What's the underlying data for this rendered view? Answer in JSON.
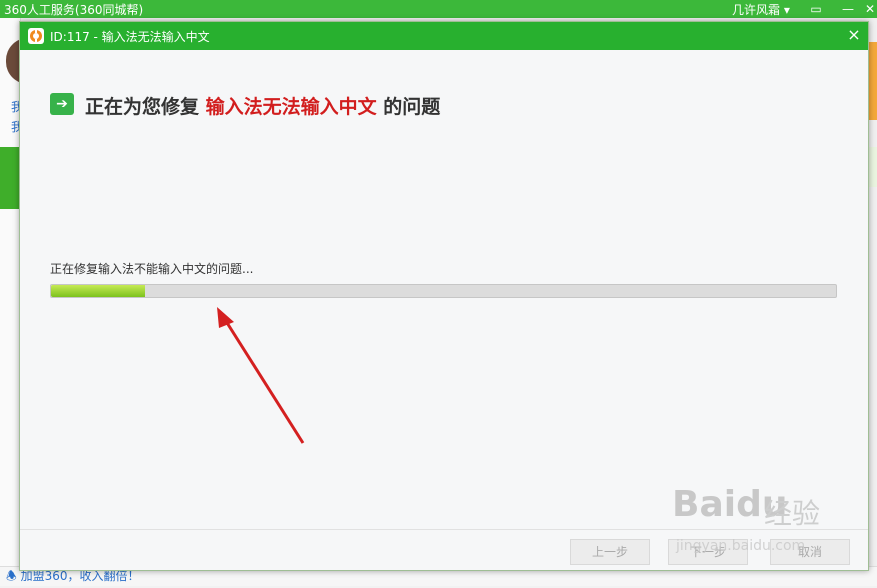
{
  "background_window": {
    "title": "360人工服务(360同城帮)",
    "user_menu": "几许风霜 ▾",
    "link_1": "我",
    "link_2": "我",
    "bottom_text": "加盟360，收入翻倍！"
  },
  "dialog": {
    "title": "ID:117 - 输入法无法输入中文",
    "close_glyph": "×",
    "heading_prefix": "正在为您修复 ",
    "heading_highlight": "输入法无法输入中文",
    "heading_suffix": " 的问题",
    "status_text": "正在修复输入法不能输入中文的问题...",
    "progress_percent": 12,
    "buttons": {
      "prev": "上一步",
      "next": "下一步",
      "cancel": "取消"
    }
  },
  "watermark": {
    "brand": "Baidu",
    "sub": "经验",
    "url": "jingyan.baidu.com"
  },
  "colors": {
    "title_green": "#28b02f",
    "highlight_red": "#d21e1e",
    "progress_green": "#7cc21d",
    "arrow_red": "#d42020"
  }
}
